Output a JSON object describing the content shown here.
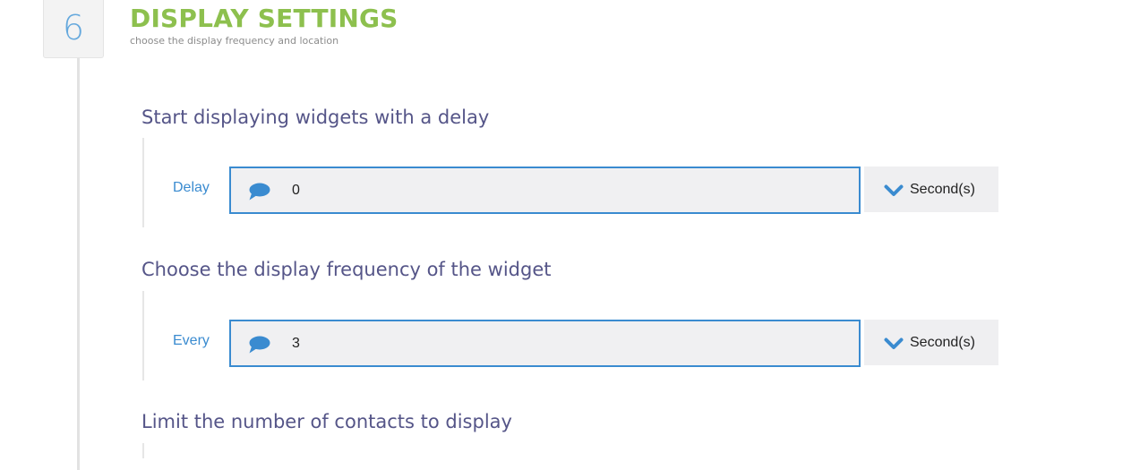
{
  "step": {
    "number": "6",
    "title": "DISPLAY SETTINGS",
    "subtitle": "choose the display frequency and location"
  },
  "groups": [
    {
      "title": "Start displaying widgets with a delay",
      "field_label": "Delay",
      "input_value": "0",
      "input_icon": "comment-icon",
      "unit_label": "Second(s)",
      "unit_icon": "chevron-down-icon"
    },
    {
      "title": "Choose the display frequency of the widget",
      "field_label": "Every",
      "input_value": "3",
      "input_icon": "comment-icon",
      "unit_label": "Second(s)",
      "unit_icon": "chevron-down-icon"
    },
    {
      "title": "Limit the number of contacts to display"
    }
  ],
  "colors": {
    "title_green": "#8dc04e",
    "step_number_blue": "#64a8dd",
    "group_title_purple": "#555588",
    "accent_blue": "#3a8bd0",
    "input_background": "#f0f0f2"
  }
}
